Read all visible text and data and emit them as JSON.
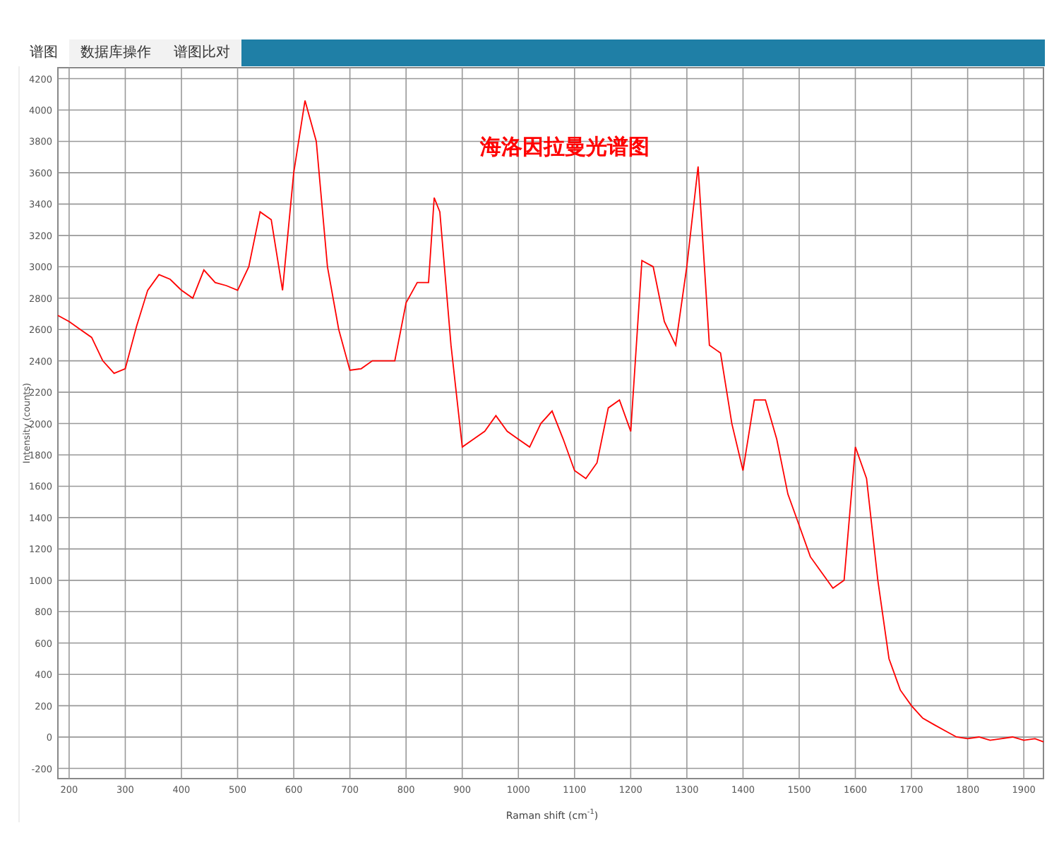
{
  "tabs": [
    {
      "label": "谱图",
      "selected": true
    },
    {
      "label": "数据库操作",
      "selected": false
    },
    {
      "label": "谱图比对",
      "selected": false
    }
  ],
  "chart": {
    "chart_data": {
      "type": "line",
      "title": "海洛因拉曼光谱图",
      "xlabel": "Raman shift (cm$^{-1}$)",
      "ylabel": "Intensity (counts)",
      "x": [
        180,
        200,
        220,
        240,
        260,
        280,
        300,
        320,
        340,
        360,
        380,
        400,
        420,
        440,
        460,
        480,
        500,
        520,
        540,
        560,
        580,
        600,
        620,
        640,
        660,
        680,
        700,
        720,
        740,
        760,
        780,
        800,
        820,
        840,
        850,
        860,
        880,
        900,
        920,
        940,
        960,
        980,
        1000,
        1020,
        1040,
        1060,
        1080,
        1100,
        1120,
        1140,
        1160,
        1180,
        1200,
        1220,
        1240,
        1260,
        1280,
        1300,
        1320,
        1340,
        1360,
        1380,
        1400,
        1420,
        1440,
        1460,
        1480,
        1500,
        1520,
        1540,
        1560,
        1580,
        1600,
        1620,
        1640,
        1660,
        1680,
        1700,
        1720,
        1740,
        1760,
        1780,
        1800,
        1820,
        1840,
        1860,
        1880,
        1900,
        1920,
        1935
      ],
      "series": [
        {
          "color": "#ff0000",
          "values": [
            2690,
            2650,
            2600,
            2550,
            2400,
            2320,
            2350,
            2620,
            2850,
            2950,
            2920,
            2850,
            2800,
            2980,
            2900,
            2880,
            2850,
            3000,
            3350,
            3300,
            2850,
            3600,
            4060,
            3800,
            3000,
            2600,
            2340,
            2350,
            2400,
            2400,
            2400,
            2770,
            2900,
            2900,
            3440,
            3350,
            2500,
            1850,
            1900,
            1950,
            2050,
            1950,
            1900,
            1850,
            2000,
            2080,
            1900,
            1700,
            1650,
            1750,
            2100,
            2150,
            1950,
            3040,
            3000,
            2650,
            2500,
            3000,
            3640,
            2500,
            2450,
            2000,
            1700,
            2150,
            2150,
            1900,
            1550,
            1350,
            1150,
            1050,
            950,
            1000,
            1850,
            1650,
            1000,
            500,
            300,
            200,
            120,
            80,
            40,
            0,
            -10,
            0,
            -20,
            -10,
            0,
            -20,
            -10,
            -30
          ]
        }
      ],
      "grid": true,
      "xlim": [
        180,
        1935
      ],
      "ylim": [
        -265,
        4270
      ],
      "xticks": [
        200,
        300,
        400,
        500,
        600,
        700,
        800,
        900,
        1000,
        1100,
        1200,
        1300,
        1400,
        1500,
        1600,
        1700,
        1800,
        1900
      ],
      "yticks": [
        -200,
        0,
        200,
        400,
        600,
        800,
        1000,
        1200,
        1400,
        1600,
        1800,
        2000,
        2200,
        2400,
        2600,
        2800,
        3000,
        3200,
        3400,
        3600,
        3800,
        4000,
        4200
      ]
    }
  }
}
